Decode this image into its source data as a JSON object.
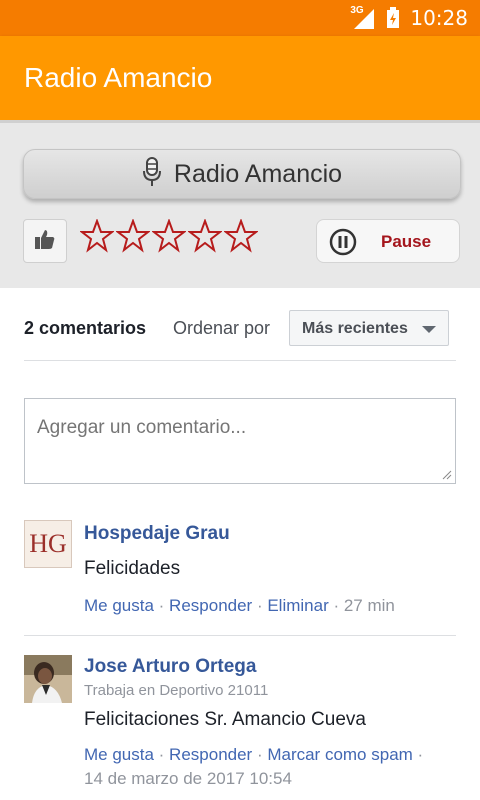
{
  "status_bar": {
    "network": "3G",
    "time": "10:28"
  },
  "app_bar": {
    "title": "Radio Amancio"
  },
  "player": {
    "station_label": "Radio Amancio",
    "rating": 0,
    "max_rating": 5,
    "pause_label": "Pause"
  },
  "comments": {
    "count_label": "2 comentarios",
    "order_label": "Ordenar por",
    "order_value": "Más recientes",
    "placeholder": "Agregar un comentario...",
    "items": [
      {
        "author": "Hospedaje Grau",
        "avatar_initials": "HG",
        "text": "Felicidades",
        "like": "Me gusta",
        "reply": "Responder",
        "extra": "Eliminar",
        "time": "27 min"
      },
      {
        "author": "Jose Arturo Ortega",
        "subtitle": "Trabaja en Deportivo 21011",
        "text": "Felicitaciones Sr. Amancio Cueva",
        "like": "Me gusta",
        "reply": "Responder",
        "extra": "Marcar como spam",
        "time": "14 de marzo de 2017 10:54"
      }
    ]
  },
  "colors": {
    "status_bar": "#f57c00",
    "app_bar": "#ff9800",
    "star_outline": "#b71c1c",
    "link": "#4267b2",
    "author": "#365899"
  }
}
